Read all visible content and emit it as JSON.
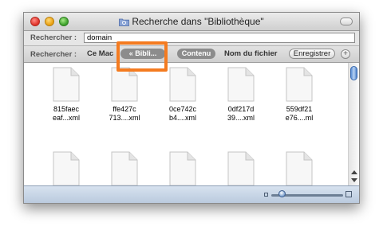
{
  "window": {
    "title": "Recherche dans \"Bibliothèque\""
  },
  "search": {
    "label": "Rechercher :",
    "value": "domain"
  },
  "scope": {
    "label": "Rechercher :",
    "this_mac": "Ce Mac",
    "library_pill": "« Bibli...",
    "content_pill": "Contenu",
    "filename": "Nom du fichier",
    "save_button": "Enregistrer",
    "add_button": "+"
  },
  "files": [
    {
      "line1": "815faec",
      "line2": "eaf...xml"
    },
    {
      "line1": "ffe427c",
      "line2": "713....xml"
    },
    {
      "line1": "0ce742c",
      "line2": "b4....xml"
    },
    {
      "line1": "0df217d",
      "line2": "39....xml"
    },
    {
      "line1": "559df21",
      "line2": "e76....ml"
    }
  ],
  "colors": {
    "highlight": "#f47b20",
    "scope_pill": "#8c8c8c",
    "statusbar": "#c8d6e6"
  },
  "icons": [
    "folder-icon",
    "document-icon",
    "plus-icon"
  ]
}
